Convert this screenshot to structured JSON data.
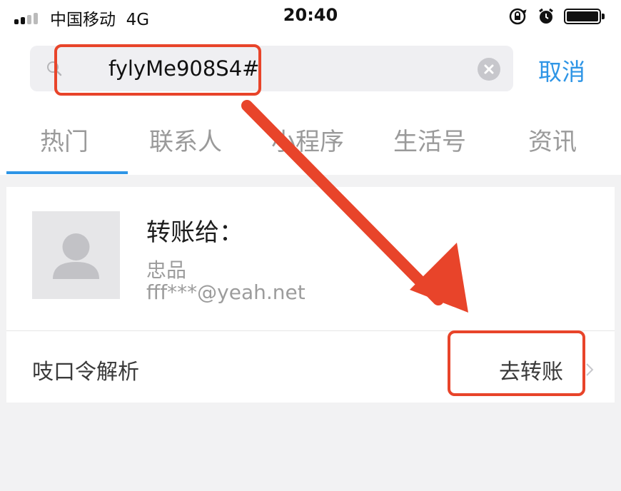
{
  "status_bar": {
    "carrier": "中国移动",
    "network": "4G",
    "time": "20:40"
  },
  "search": {
    "query": "fylyMe908S4#",
    "cancel_label": "取消"
  },
  "tabs": [
    {
      "label": "热门",
      "active": true
    },
    {
      "label": "联系人",
      "active": false
    },
    {
      "label": "小程序",
      "active": false
    },
    {
      "label": "生活号",
      "active": false
    },
    {
      "label": "资讯",
      "active": false
    }
  ],
  "transfer_card": {
    "title": "转账给：",
    "recipient_name": "忠品",
    "recipient_account": "fff***@yeah.net",
    "command_label": "吱口令解析",
    "action_label": "去转账"
  },
  "colors": {
    "accent": "#2e95e6",
    "annotation": "#e8442a",
    "background": "#f2f2f3"
  },
  "icons": [
    "signal-icon",
    "orientation-lock-icon",
    "alarm-icon",
    "battery-icon",
    "search-icon",
    "clear-icon",
    "avatar-placeholder-icon",
    "chevron-right-icon"
  ]
}
